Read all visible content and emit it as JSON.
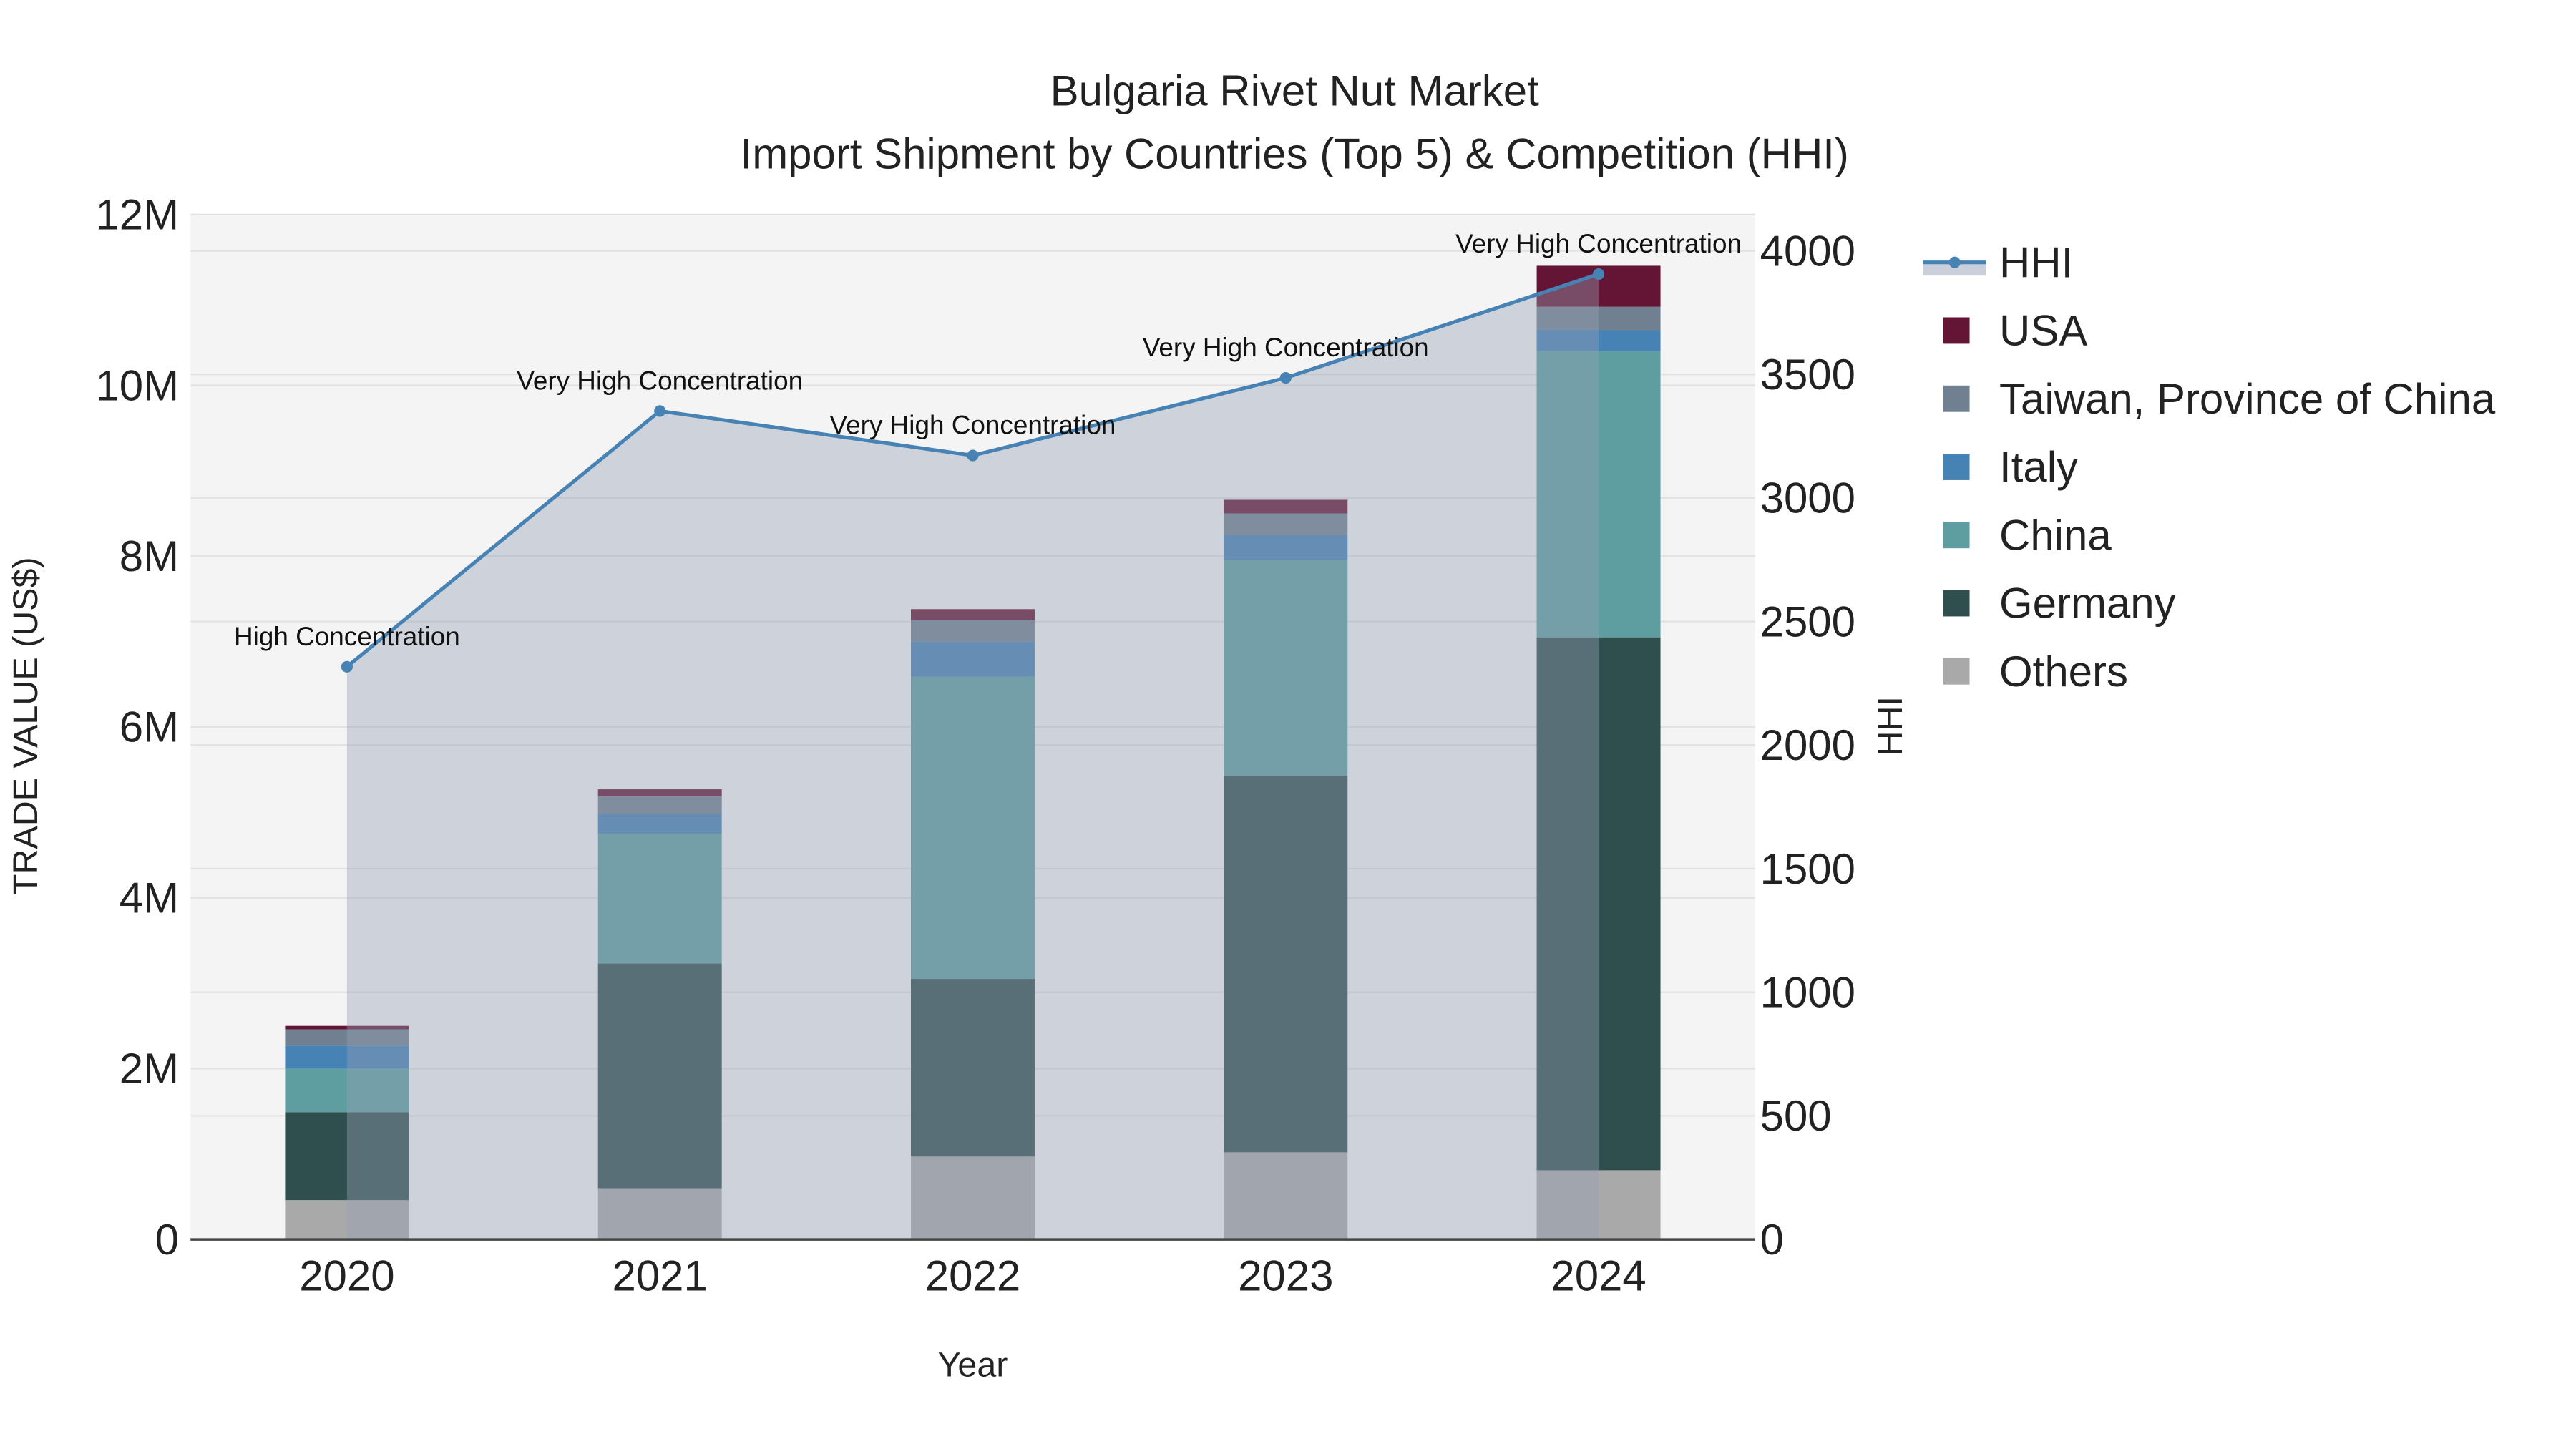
{
  "chart_data": {
    "type": "bar",
    "stacked": true,
    "title": "Bulgaria Rivet Nut Market",
    "subtitle": "Import Shipment by Countries (Top 5) & Competition (HHI)",
    "xlabel": "Year",
    "ylabel": "TRADE VALUE (US$)",
    "y2label": "HHI",
    "ylim": [
      0,
      12000000
    ],
    "y2lim": [
      0,
      4133
    ],
    "grid": true,
    "legend_position": "right",
    "categories": [
      "2020",
      "2021",
      "2022",
      "2023",
      "2024"
    ],
    "y_ticks": [
      {
        "value": 0,
        "label": "0"
      },
      {
        "value": 2000000,
        "label": "2M"
      },
      {
        "value": 4000000,
        "label": "4M"
      },
      {
        "value": 6000000,
        "label": "6M"
      },
      {
        "value": 8000000,
        "label": "8M"
      },
      {
        "value": 10000000,
        "label": "10M"
      },
      {
        "value": 12000000,
        "label": "12M"
      }
    ],
    "y2_ticks": [
      {
        "value": 0,
        "label": "0"
      },
      {
        "value": 500,
        "label": "500"
      },
      {
        "value": 1000,
        "label": "1000"
      },
      {
        "value": 1500,
        "label": "1500"
      },
      {
        "value": 2000,
        "label": "2000"
      },
      {
        "value": 2500,
        "label": "2500"
      },
      {
        "value": 3000,
        "label": "3000"
      },
      {
        "value": 3500,
        "label": "3500"
      },
      {
        "value": 4000,
        "label": "4000"
      }
    ],
    "series": [
      {
        "name": "Others",
        "color": "#a9a9a9",
        "values": [
          460000,
          600000,
          970000,
          1020000,
          810000
        ]
      },
      {
        "name": "Germany",
        "color": "#2f4f4f",
        "values": [
          1030000,
          2630000,
          2080000,
          4410000,
          6240000
        ]
      },
      {
        "name": "China",
        "color": "#5f9ea0",
        "values": [
          510000,
          1520000,
          3540000,
          2530000,
          3350000
        ]
      },
      {
        "name": "Italy",
        "color": "#4682b4",
        "values": [
          270000,
          230000,
          410000,
          290000,
          250000
        ]
      },
      {
        "name": "Taiwan, Province of China",
        "color": "#708090",
        "values": [
          190000,
          210000,
          250000,
          250000,
          270000
        ]
      },
      {
        "name": "USA",
        "color": "#641434",
        "values": [
          40000,
          80000,
          130000,
          160000,
          480000
        ]
      }
    ],
    "hhi": {
      "name": "HHI",
      "color": "#4682b4",
      "values": [
        2317,
        3352,
        3172,
        3486,
        3906
      ],
      "annotations": [
        "High Concentration",
        "Very High Concentration",
        "Very High Concentration",
        "Very High Concentration",
        "Very High Concentration"
      ]
    },
    "legend_order": [
      "HHI",
      "USA",
      "Taiwan, Province of China",
      "Italy",
      "China",
      "Germany",
      "Others"
    ]
  }
}
